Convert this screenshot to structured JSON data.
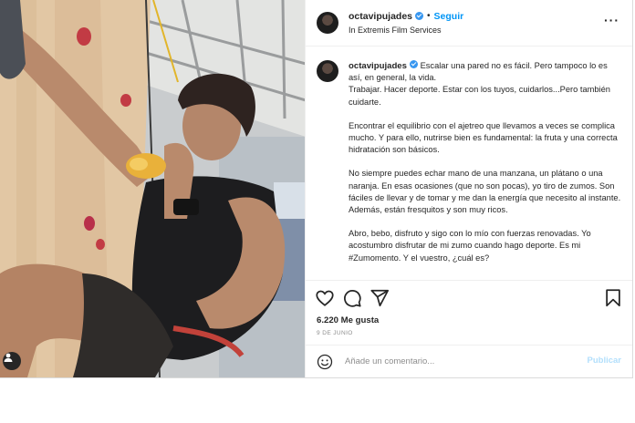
{
  "post": {
    "username": "octavipujades",
    "follow_label": "Seguir",
    "separator": "•",
    "location": "In Extremis Film Services",
    "more_label": "···",
    "caption": {
      "username": "octavipujades",
      "p1_rest": " Escalar una pared no es fácil. Pero tampoco lo es así, en general, la vida.",
      "p1_line2": "Trabajar. Hacer deporte. Estar con los tuyos, cuidarlos...Pero también cuidarte.",
      "p2": "Encontrar el equilibrio con el ajetreo que llevamos a veces se complica mucho. Y para ello, nutrirse bien es fundamental: la fruta y una correcta hidratación son básicos.",
      "p3": "No siempre puedes echar mano de una manzana, un plátano o una naranja. En esas ocasiones (que no son pocas), yo tiro de zumos. Son fáciles de llevar y de tomar y me dan la energía que necesito al instante. Además, están fresquitos y son muy ricos.",
      "p4": "Abro, bebo, disfruto y sigo con lo mío con fuerzas renovadas. Yo acostumbro disfrutar de mi zumo cuando hago deporte. Es mi #Zumomento. Y el vuestro, ¿cuál es?"
    },
    "likes": "6.220 Me gusta",
    "date": "9 DE JUNIO",
    "comment_placeholder": "Añade un comentario...",
    "publish_label": "Publicar",
    "icons": {
      "like": "heart-icon",
      "comment": "comment-icon",
      "share": "share-icon",
      "save": "bookmark-icon",
      "emoji": "emoji-icon",
      "user_tag": "user-tag-icon"
    },
    "colors": {
      "accent": "#0095f6",
      "verified": "#3897f0",
      "publish_disabled": "#b2dffc"
    }
  }
}
